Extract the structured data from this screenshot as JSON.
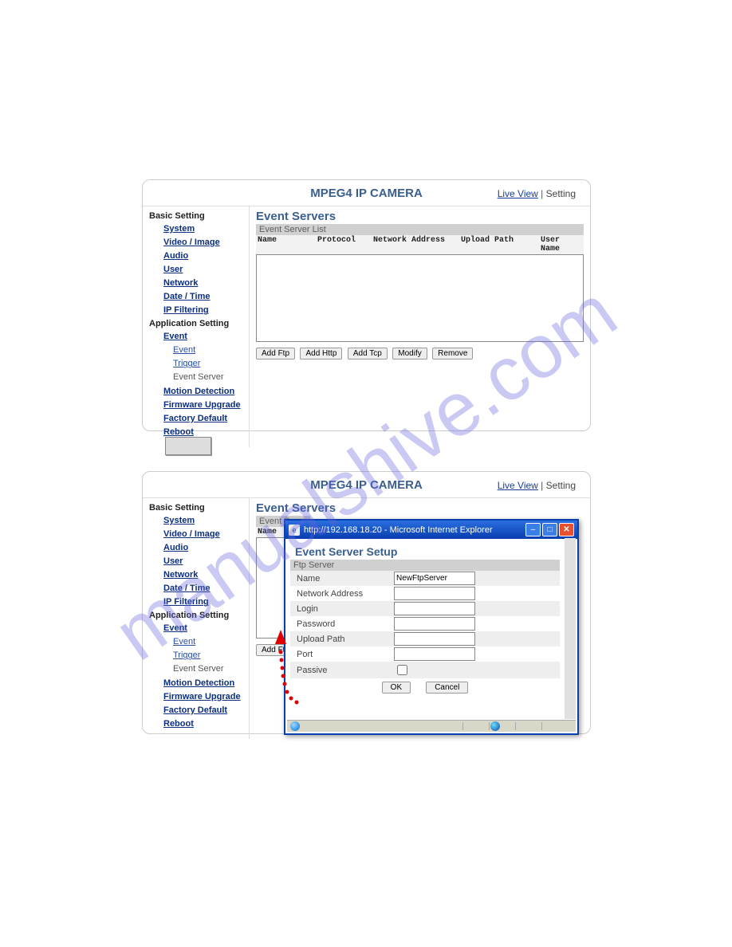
{
  "watermark": "manualshive.com",
  "header": {
    "title": "MPEG4 IP CAMERA",
    "live_view": "Live View",
    "separator": "|",
    "setting": "Setting"
  },
  "sidebar": {
    "basic_heading": "Basic Setting",
    "basic": {
      "system": "System",
      "video_image": "Video / Image",
      "audio": "Audio",
      "user": "User",
      "network": "Network",
      "date_time": "Date / Time",
      "ip_filtering": "IP Filtering"
    },
    "app_heading": "Application Setting",
    "app": {
      "event": "Event",
      "event_sub": "Event",
      "trigger_sub": "Trigger",
      "event_server": "Event Server",
      "motion_detection": "Motion Detection",
      "firmware_upgrade": "Firmware Upgrade",
      "factory_default": "Factory Default",
      "reboot": "Reboot"
    }
  },
  "content": {
    "title": "Event Servers",
    "list_label": "Event Server List",
    "columns": {
      "name": "Name",
      "protocol": "Protocol",
      "network_address": "Network Address",
      "upload_path": "Upload Path",
      "user_name": "User Name"
    },
    "buttons": {
      "add_ftp": "Add Ftp",
      "add_http": "Add Http",
      "add_tcp": "Add Tcp",
      "modify": "Modify",
      "remove": "Remove"
    }
  },
  "popup": {
    "titlebar": "http://192.168.18.20 - Microsoft Internet Explorer",
    "heading": "Event Server Setup",
    "section": "Ftp Server",
    "fields": {
      "name_label": "Name",
      "name_value": "NewFtpServer",
      "network_address_label": "Network Address",
      "network_address_value": "",
      "login_label": "Login",
      "login_value": "",
      "password_label": "Password",
      "password_value": "",
      "upload_path_label": "Upload Path",
      "upload_path_value": "",
      "port_label": "Port",
      "port_value": "",
      "passive_label": "Passive"
    },
    "ok": "OK",
    "cancel": "Cancel"
  }
}
